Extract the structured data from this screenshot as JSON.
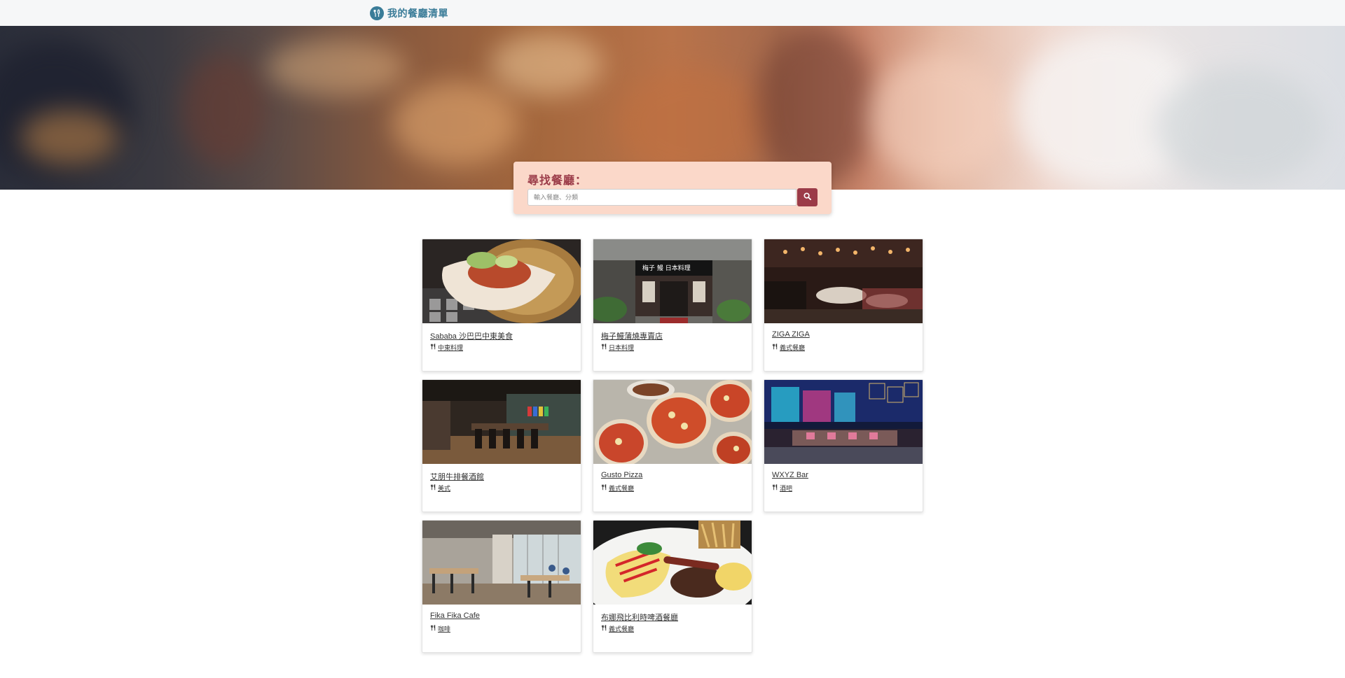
{
  "navbar": {
    "brand_text": "我的餐廳清單",
    "brand_icon": "utensils-icon"
  },
  "search": {
    "title": "尋找餐廳：",
    "placeholder": "輸入餐廳、分類",
    "value": "",
    "button_icon": "search-icon"
  },
  "colors": {
    "brand": "#3a7c98",
    "accent": "#9b3b48",
    "search_panel": "#fbd8c9"
  },
  "restaurants": [
    {
      "name": "Sababa 沙巴巴中東美食",
      "category": "中東料理",
      "icon": "utensils-icon"
    },
    {
      "name": "梅子鰻蒲燒專賣店",
      "category": "日本料理",
      "icon": "utensils-icon"
    },
    {
      "name": "ZIGA ZIGA",
      "category": "義式餐廳",
      "icon": "utensils-icon"
    },
    {
      "name": "艾朋牛排餐酒館",
      "category": "美式",
      "icon": "utensils-icon"
    },
    {
      "name": "Gusto Pizza",
      "category": "義式餐廳",
      "icon": "utensils-icon"
    },
    {
      "name": "WXYZ Bar",
      "category": "酒吧",
      "icon": "utensils-icon"
    },
    {
      "name": "Fika Fika Cafe",
      "category": "咖啡",
      "icon": "utensils-icon"
    },
    {
      "name": "布娜飛比利時啤酒餐廳",
      "category": "義式餐廳",
      "icon": "utensils-icon"
    }
  ]
}
